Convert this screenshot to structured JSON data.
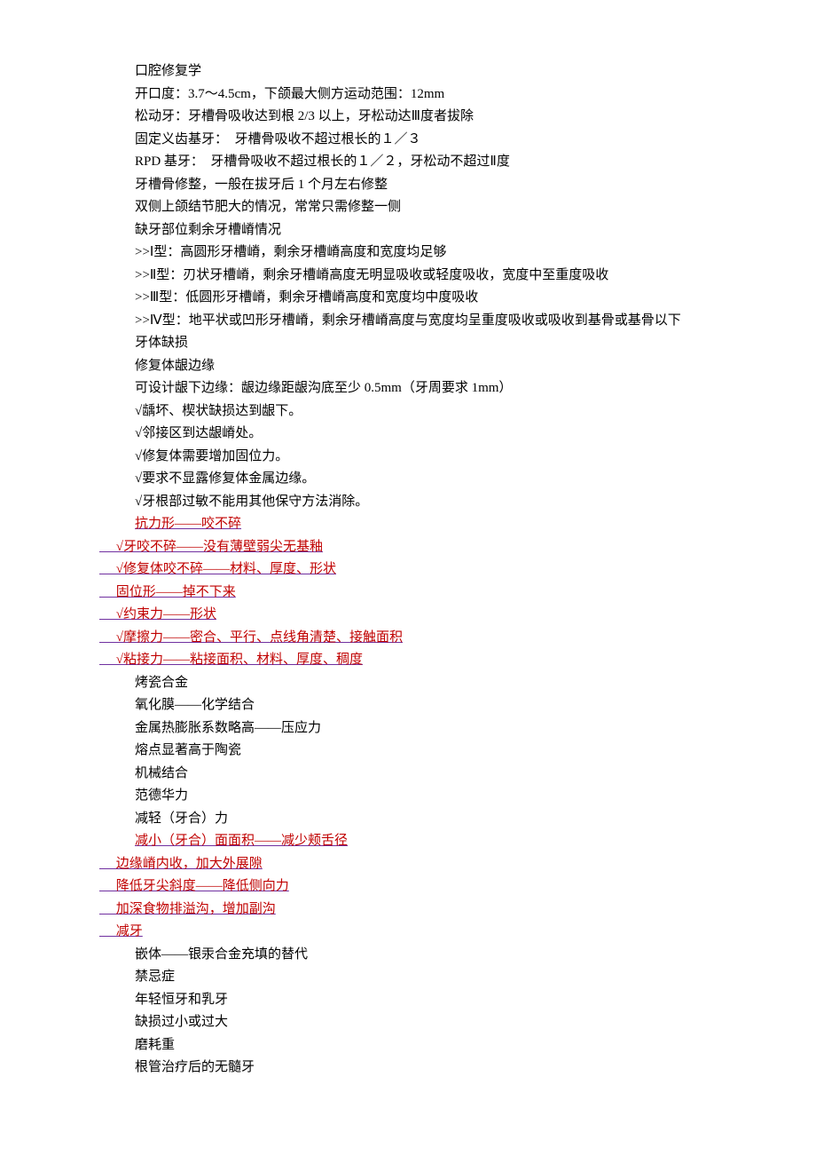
{
  "lines": [
    {
      "style": "line",
      "text": "口腔修复学"
    },
    {
      "style": "line",
      "text": "开口度：3.7～4.5cm，下颌最大侧方运动范围：12mm"
    },
    {
      "style": "line",
      "text": "松动牙：牙槽骨吸收达到根 2/3 以上，牙松动达Ⅲ度者拔除"
    },
    {
      "style": "line",
      "text": "固定义齿基牙：  牙槽骨吸收不超过根长的１／３"
    },
    {
      "style": "line",
      "text": "RPD 基牙：  牙槽骨吸收不超过根长的１／２，牙松动不超过Ⅱ度"
    },
    {
      "style": "line",
      "text": "牙槽骨修整，一般在拔牙后 1 个月左右修整"
    },
    {
      "style": "line",
      "text": "双侧上颌结节肥大的情况，常常只需修整一侧"
    },
    {
      "style": "line",
      "text": "缺牙部位剩余牙槽嵴情况"
    },
    {
      "style": "line",
      "text": ">>Ⅰ型：高圆形牙槽嵴，剩余牙槽嵴高度和宽度均足够"
    },
    {
      "style": "line",
      "text": ">>Ⅱ型：刃状牙槽嵴，剩余牙槽嵴高度无明显吸收或轻度吸收，宽度中至重度吸收"
    },
    {
      "style": "line",
      "text": ">>Ⅲ型：低圆形牙槽嵴，剩余牙槽嵴高度和宽度均中度吸收"
    },
    {
      "style": "line",
      "text": ">>Ⅳ型：地平状或凹形牙槽嵴，剩余牙槽嵴高度与宽度均呈重度吸收或吸收到基骨或基骨以下"
    },
    {
      "style": "line",
      "text": "牙体缺损"
    },
    {
      "style": "line",
      "text": "修复体龈边缘"
    },
    {
      "style": "line",
      "text": "可设计龈下边缘：龈边缘距龈沟底至少 0.5mm（牙周要求 1mm）"
    },
    {
      "style": "line",
      "text": "√龋坏、楔状缺损达到龈下。"
    },
    {
      "style": "line",
      "text": "√邻接区到达龈嵴处。"
    },
    {
      "style": "line",
      "text": "√修复体需要增加固位力。"
    },
    {
      "style": "line",
      "text": "√要求不显露修复体金属边缘。"
    },
    {
      "style": "line",
      "text": "√牙根部过敏不能用其他保守方法消除。"
    },
    {
      "style": "link-line",
      "text": "抗力形——咬不碎"
    },
    {
      "style": "link-line-lead",
      "text": "     √牙咬不碎——没有薄壁弱尖无基釉"
    },
    {
      "style": "link-line-lead",
      "text": "     √修复体咬不碎——材料、厚度、形状"
    },
    {
      "style": "link-line-lead",
      "text": "     固位形——掉不下来"
    },
    {
      "style": "link-line-lead",
      "text": "     √约束力——形状"
    },
    {
      "style": "link-line-lead",
      "text": "     √摩擦力——密合、平行、点线角清楚、接触面积"
    },
    {
      "style": "link-line-lead",
      "text": "     √粘接力——粘接面积、材料、厚度、稠度"
    },
    {
      "style": "line",
      "text": "烤瓷合金"
    },
    {
      "style": "line",
      "text": "氧化膜——化学结合"
    },
    {
      "style": "line",
      "text": "金属热膨胀系数略高——压应力"
    },
    {
      "style": "line",
      "text": "熔点显著高于陶瓷"
    },
    {
      "style": "line",
      "text": "机械结合"
    },
    {
      "style": "line",
      "text": "范德华力"
    },
    {
      "style": "line",
      "text": "减轻（牙合）力"
    },
    {
      "style": "link-line",
      "text": "减小（牙合）面面积——减少颊舌径"
    },
    {
      "style": "link-line-lead",
      "text": "     边缘嵴内收，加大外展隙"
    },
    {
      "style": "link-line-lead",
      "text": "     降低牙尖斜度——降低侧向力"
    },
    {
      "style": "link-line-lead",
      "text": "     加深食物排溢沟，增加副沟"
    },
    {
      "style": "link-line-lead",
      "text": "     减牙"
    },
    {
      "style": "line",
      "text": "嵌体——银汞合金充填的替代"
    },
    {
      "style": "line",
      "text": "禁忌症"
    },
    {
      "style": "line",
      "text": "年轻恒牙和乳牙"
    },
    {
      "style": "line",
      "text": "缺损过小或过大"
    },
    {
      "style": "line",
      "text": "磨耗重"
    },
    {
      "style": "line",
      "text": "根管治疗后的无髓牙"
    }
  ]
}
